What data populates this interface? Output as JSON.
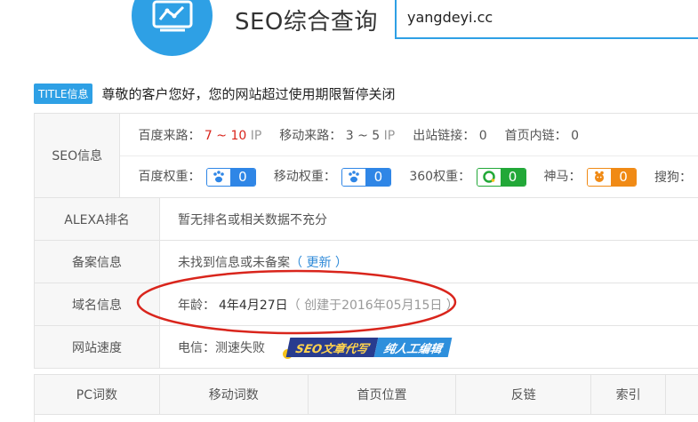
{
  "header": {
    "title": "SEO综合查询",
    "search_value": "yangdeyi.cc"
  },
  "notice": {
    "badge": "TITLE信息",
    "text": "尊敬的客户您好，您的网站超过使用期限暂停关闭"
  },
  "seo_info": {
    "label": "SEO信息",
    "baidu_traffic_label": "百度来路：",
    "baidu_traffic_value": "7 ~ 10",
    "ip_unit": "IP",
    "mobile_traffic_label": "移动来路：",
    "mobile_traffic_value": "3 ~ 5",
    "outbound_label": "出站链接：",
    "outbound_value": "0",
    "internal_label": "首页内链：",
    "internal_value": "0",
    "baidu_weight_label": "百度权重：",
    "baidu_weight_value": "0",
    "mobile_weight_label": "移动权重：",
    "mobile_weight_value": "0",
    "so360_weight_label": "360权重：",
    "so360_weight_value": "0",
    "shenma_label": "神马：",
    "shenma_value": "0",
    "sogou_label": "搜狗："
  },
  "alexa": {
    "label": "ALEXA排名",
    "value": "暂无排名或相关数据不充分"
  },
  "icp": {
    "label": "备案信息",
    "value": "未找到信息或未备案",
    "update_link": "（ 更新 ）"
  },
  "domain": {
    "label": "域名信息",
    "age_label": "年龄：",
    "age_value": "4年4月27日",
    "created": "（ 创建于2016年05月15日 ）"
  },
  "speed": {
    "label": "网站速度",
    "value": "电信：测速失败",
    "banner_left": "SEO文章代写",
    "banner_right": "纯人工编辑"
  },
  "rank_table": {
    "columns": [
      "PC词数",
      "移动词数",
      "首页位置",
      "反链",
      "索引"
    ]
  },
  "colors": {
    "accent": "#2ea0e5",
    "baidu_blue": "#2f86e6",
    "green_360": "#22a838",
    "shenma_orange": "#f08a15",
    "highlight_red": "#d9251c"
  }
}
